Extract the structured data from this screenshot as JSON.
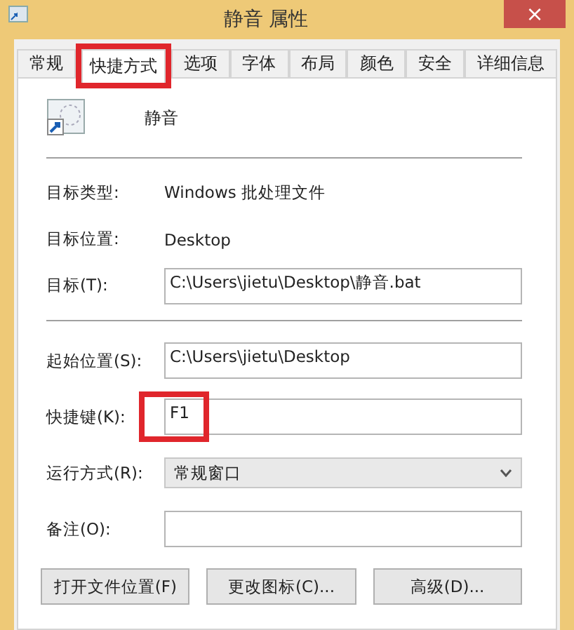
{
  "window": {
    "title": "静音 属性",
    "close": "×"
  },
  "tabs": [
    {
      "label": "常规",
      "selected": false,
      "highlighted": false
    },
    {
      "label": "快捷方式",
      "selected": true,
      "highlighted": true
    },
    {
      "label": "选项",
      "selected": false,
      "highlighted": false
    },
    {
      "label": "字体",
      "selected": false,
      "highlighted": false
    },
    {
      "label": "布局",
      "selected": false,
      "highlighted": false
    },
    {
      "label": "颜色",
      "selected": false,
      "highlighted": false
    },
    {
      "label": "安全",
      "selected": false,
      "highlighted": false
    },
    {
      "label": "详细信息",
      "selected": false,
      "highlighted": false
    }
  ],
  "shortcut_name": "静音",
  "info": [
    {
      "label": "目标类型:",
      "value": "Windows 批处理文件"
    },
    {
      "label": "目标位置:",
      "value": "Desktop"
    }
  ],
  "target": {
    "label": "目标(T):",
    "value": "C:\\Users\\jietu\\Desktop\\静音.bat"
  },
  "fields": [
    {
      "kind": "text",
      "label": "起始位置(S):",
      "value": "C:\\Users\\jietu\\Desktop",
      "highlighted": false
    },
    {
      "kind": "text",
      "label": "快捷键(K):",
      "value": "F1",
      "highlighted": true
    },
    {
      "kind": "select",
      "label": "运行方式(R):",
      "value": "常规窗口",
      "highlighted": false
    },
    {
      "kind": "text",
      "label": "备注(O):",
      "highlighted": false
    }
  ],
  "buttons": [
    "打开文件位置(F)",
    "更改图标(C)...",
    "高级(D)..."
  ]
}
